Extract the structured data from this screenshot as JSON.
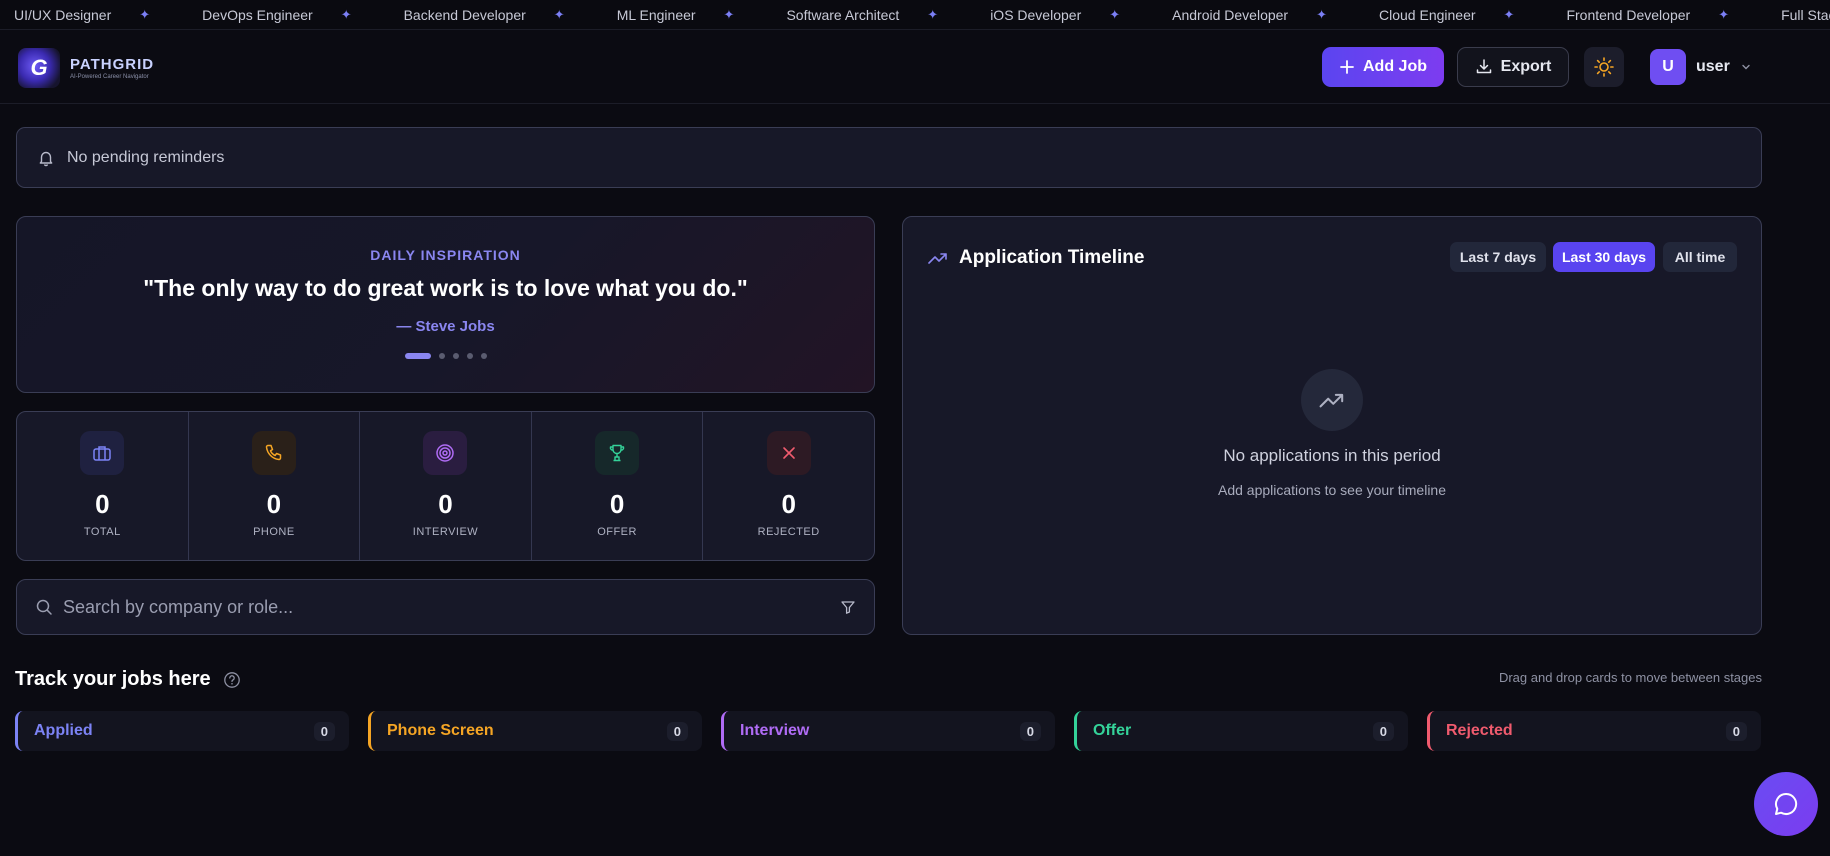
{
  "ticker": [
    "UI/UX Designer",
    "DevOps Engineer",
    "Backend Developer",
    "ML Engineer",
    "Software Architect",
    "iOS Developer",
    "Android Developer",
    "Cloud Engineer",
    "Frontend Developer",
    "Full Stack Engineer"
  ],
  "ticker_separator": "✦",
  "brand": {
    "title": "PATHGRID",
    "subtitle": "AI-Powered Career Navigator",
    "mark": "G"
  },
  "header": {
    "add_job_label": "Add Job",
    "export_label": "Export",
    "user_initial": "U",
    "user_name": "user"
  },
  "reminders": {
    "text": "No pending reminders"
  },
  "inspiration": {
    "label": "DAILY INSPIRATION",
    "quote": "\"The only way to do great work is to love what you do.\"",
    "author": "— Steve Jobs",
    "slides": 5,
    "active_slide": 0
  },
  "stats": [
    {
      "label": "TOTAL",
      "value": "0",
      "icon": "briefcase-icon",
      "color": "#7c83f5",
      "bg": "#1f2140"
    },
    {
      "label": "PHONE",
      "value": "0",
      "icon": "phone-icon",
      "color": "#f5a524",
      "bg": "#2a2019"
    },
    {
      "label": "INTERVIEW",
      "value": "0",
      "icon": "target-icon",
      "color": "#b06cf5",
      "bg": "#2a1d40"
    },
    {
      "label": "OFFER",
      "value": "0",
      "icon": "trophy-icon",
      "color": "#34d399",
      "bg": "#16282a"
    },
    {
      "label": "REJECTED",
      "value": "0",
      "icon": "x-icon",
      "color": "#f05b6e",
      "bg": "#2d1a24"
    }
  ],
  "search": {
    "placeholder": "Search by company or role..."
  },
  "timeline": {
    "title": "Application Timeline",
    "ranges": [
      "Last 7 days",
      "Last 30 days",
      "All time"
    ],
    "active_range": "Last 30 days",
    "empty_title": "No applications in this period",
    "empty_subtitle": "Add applications to see your timeline"
  },
  "board": {
    "title": "Track your jobs here",
    "hint": "Drag and drop cards to move between stages",
    "lanes": [
      {
        "label": "Applied",
        "count": "0",
        "color": "#7c83f5"
      },
      {
        "label": "Phone Screen",
        "count": "0",
        "color": "#f5a524"
      },
      {
        "label": "Interview",
        "count": "0",
        "color": "#b06cf5"
      },
      {
        "label": "Offer",
        "count": "0",
        "color": "#34d399"
      },
      {
        "label": "Rejected",
        "count": "0",
        "color": "#f05b6e"
      }
    ]
  },
  "colors": {
    "accent": "#5944f0",
    "background": "#0b0b12",
    "card": "#171828"
  }
}
